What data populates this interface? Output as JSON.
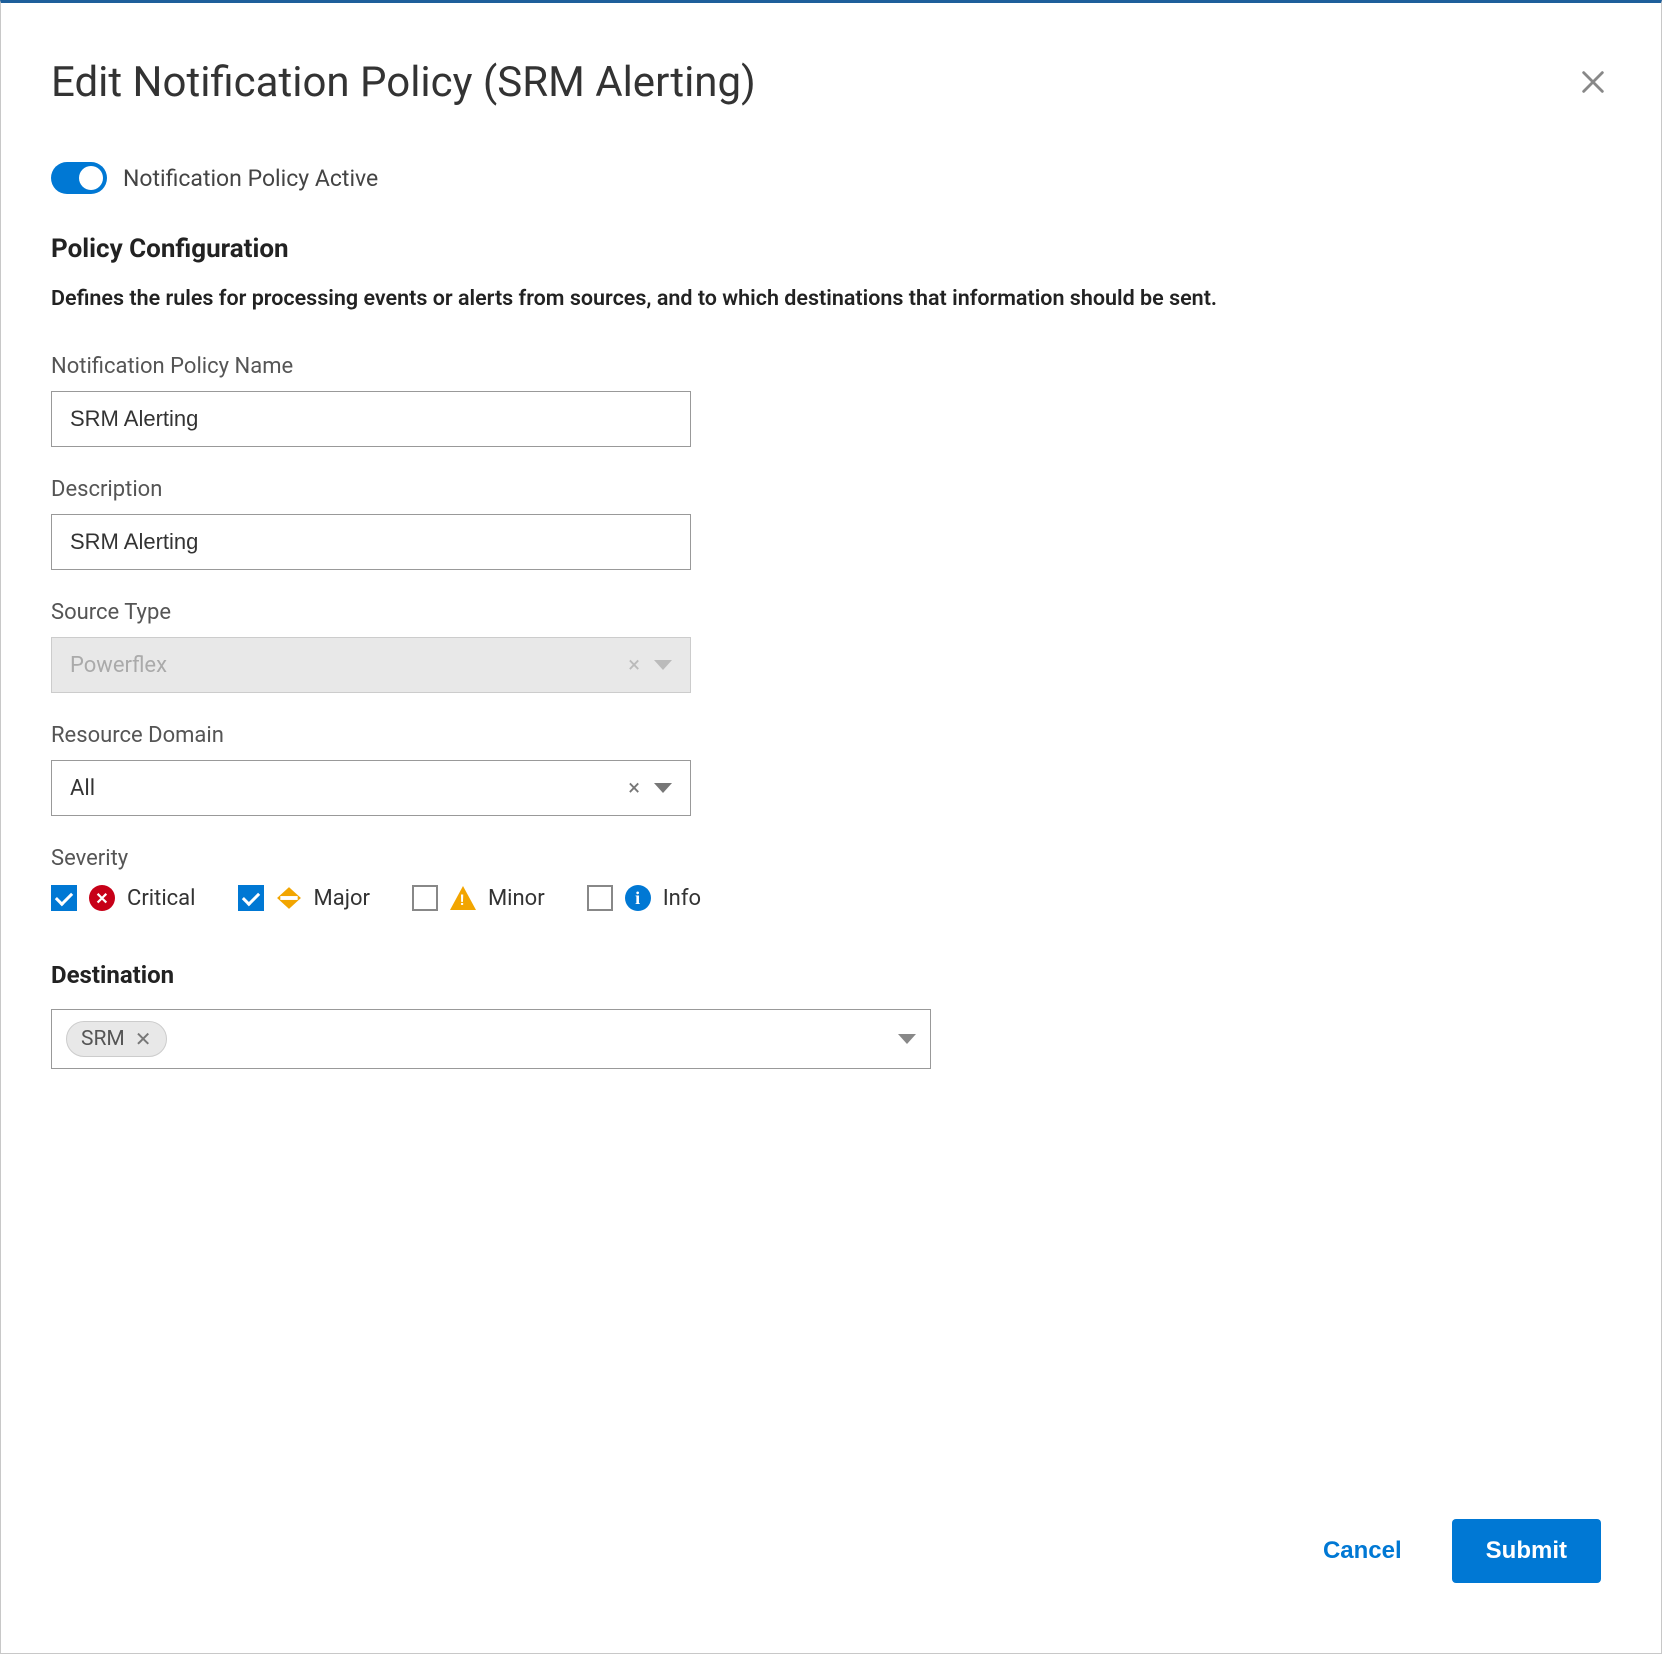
{
  "header": {
    "title": "Edit Notification Policy (SRM Alerting)"
  },
  "toggle": {
    "label": "Notification Policy Active",
    "on": true
  },
  "section": {
    "title": "Policy Configuration",
    "desc": "Defines the rules for processing events or alerts from sources, and to which destinations that information should be sent."
  },
  "fields": {
    "name": {
      "label": "Notification Policy Name",
      "value": "SRM Alerting"
    },
    "description": {
      "label": "Description",
      "value": "SRM Alerting"
    },
    "sourceType": {
      "label": "Source Type",
      "value": "Powerflex",
      "disabled": true
    },
    "resourceDomain": {
      "label": "Resource Domain",
      "value": "All"
    },
    "severity": {
      "label": "Severity",
      "items": [
        {
          "key": "critical",
          "label": "Critical",
          "checked": true
        },
        {
          "key": "major",
          "label": "Major",
          "checked": true
        },
        {
          "key": "minor",
          "label": "Minor",
          "checked": false
        },
        {
          "key": "info",
          "label": "Info",
          "checked": false
        }
      ]
    }
  },
  "destination": {
    "title": "Destination",
    "chips": [
      {
        "label": "SRM"
      }
    ]
  },
  "footer": {
    "cancel": "Cancel",
    "submit": "Submit"
  }
}
